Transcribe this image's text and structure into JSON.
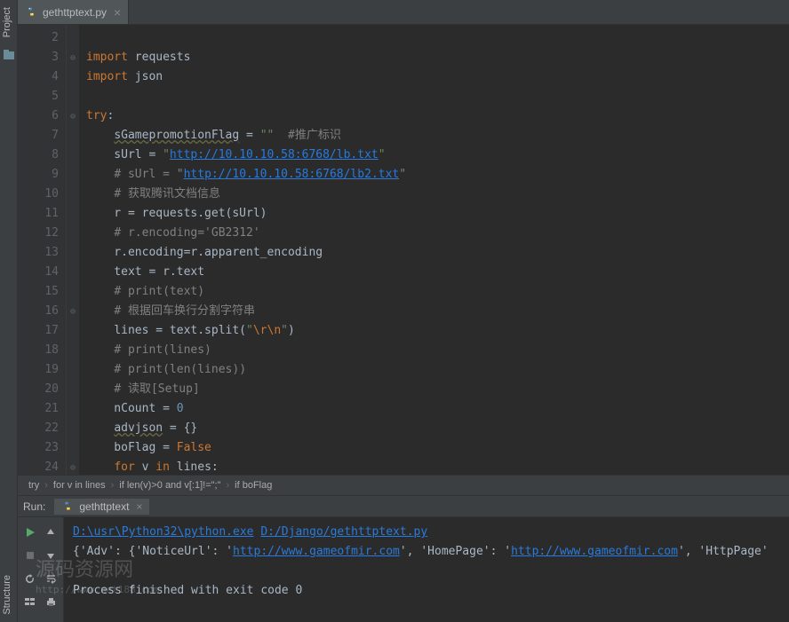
{
  "leftRail": {
    "project": "Project",
    "structure": "Structure"
  },
  "tab": {
    "filename": "gethttptext.py"
  },
  "gutter": {
    "start": 2,
    "end": 24
  },
  "code": {
    "lines": [
      {
        "n": 2,
        "html": ""
      },
      {
        "n": 3,
        "html": "<span class='kw'>import</span> <span class='ident'>requests</span>"
      },
      {
        "n": 4,
        "html": "<span class='kw'>import</span> <span class='ident'>json</span>"
      },
      {
        "n": 5,
        "html": ""
      },
      {
        "n": 6,
        "html": "<span class='kw'>try</span>:"
      },
      {
        "n": 7,
        "html": "    <span class='warn'>sGamepromotionFlag</span> = <span class='str'>\"\"</span>  <span class='cmt'>#推广标识</span>"
      },
      {
        "n": 8,
        "html": "    sUrl = <span class='str'>\"</span><span class='url'>http://10.10.10.58:6768/lb.txt</span><span class='str'>\"</span>"
      },
      {
        "n": 9,
        "html": "    <span class='cmt'># sUrl = \"</span><span class='url'>http://10.10.10.58:6768/lb2.txt</span><span class='cmt'>\"</span>"
      },
      {
        "n": 10,
        "html": "    <span class='cmt'># 获取腾讯文档信息</span>"
      },
      {
        "n": 11,
        "html": "    r = requests.get(sUrl)"
      },
      {
        "n": 12,
        "html": "    <span class='cmt'># r.encoding='GB2312'</span>"
      },
      {
        "n": 13,
        "html": "    r.encoding=r.apparent_encoding"
      },
      {
        "n": 14,
        "html": "    text = r.text"
      },
      {
        "n": 15,
        "html": "    <span class='cmt'># print(text)</span>"
      },
      {
        "n": 16,
        "html": "    <span class='cmt'># 根据回车换行分割字符串</span>"
      },
      {
        "n": 17,
        "html": "    lines = text.split(<span class='str'>\"</span><span class='kw'>\\r\\n</span><span class='str'>\"</span>)"
      },
      {
        "n": 18,
        "html": "    <span class='cmt'># print(lines)</span>"
      },
      {
        "n": 19,
        "html": "    <span class='cmt'># print(len(lines))</span>"
      },
      {
        "n": 20,
        "html": "    <span class='cmt'># 读取[Setup]</span>"
      },
      {
        "n": 21,
        "html": "    nCount = <span class='num'>0</span>"
      },
      {
        "n": 22,
        "html": "    <span class='warn'>advjson</span> = {}"
      },
      {
        "n": 23,
        "html": "    boFlag = <span class='kw'>False</span>"
      },
      {
        "n": 24,
        "html": "    <span class='kw'>for</span> v <span class='kw'>in</span> lines:"
      }
    ],
    "folds": [
      "",
      "⊖",
      "",
      "",
      "⊖",
      "",
      "",
      "",
      "",
      "",
      "",
      "",
      "",
      "",
      "⊖",
      "",
      "",
      "",
      "",
      "",
      "",
      "",
      "⊖"
    ]
  },
  "breadcrumb": {
    "items": [
      "try",
      "for v in lines",
      "if len(v)>0 and v[:1]!=\";\"",
      "if boFlag"
    ]
  },
  "runBar": {
    "label": "Run:",
    "runTab": "gethttptext"
  },
  "output": {
    "line1_a": "D:\\usr\\Python32\\python.exe",
    "line1_b": "D:/Django/gethttptext.py",
    "line2_a": "{'Adv': {'NoticeUrl': '",
    "line2_url1": "http://www.gameofmir.com",
    "line2_b": "', 'HomePage': '",
    "line2_url2": "http://www.gameofmir.com",
    "line2_c": "', 'HttpPage'",
    "line3": "",
    "line4": "Process finished with exit code 0"
  },
  "watermark": {
    "main": "源码资源网",
    "sub": "http://www.net188.com"
  }
}
